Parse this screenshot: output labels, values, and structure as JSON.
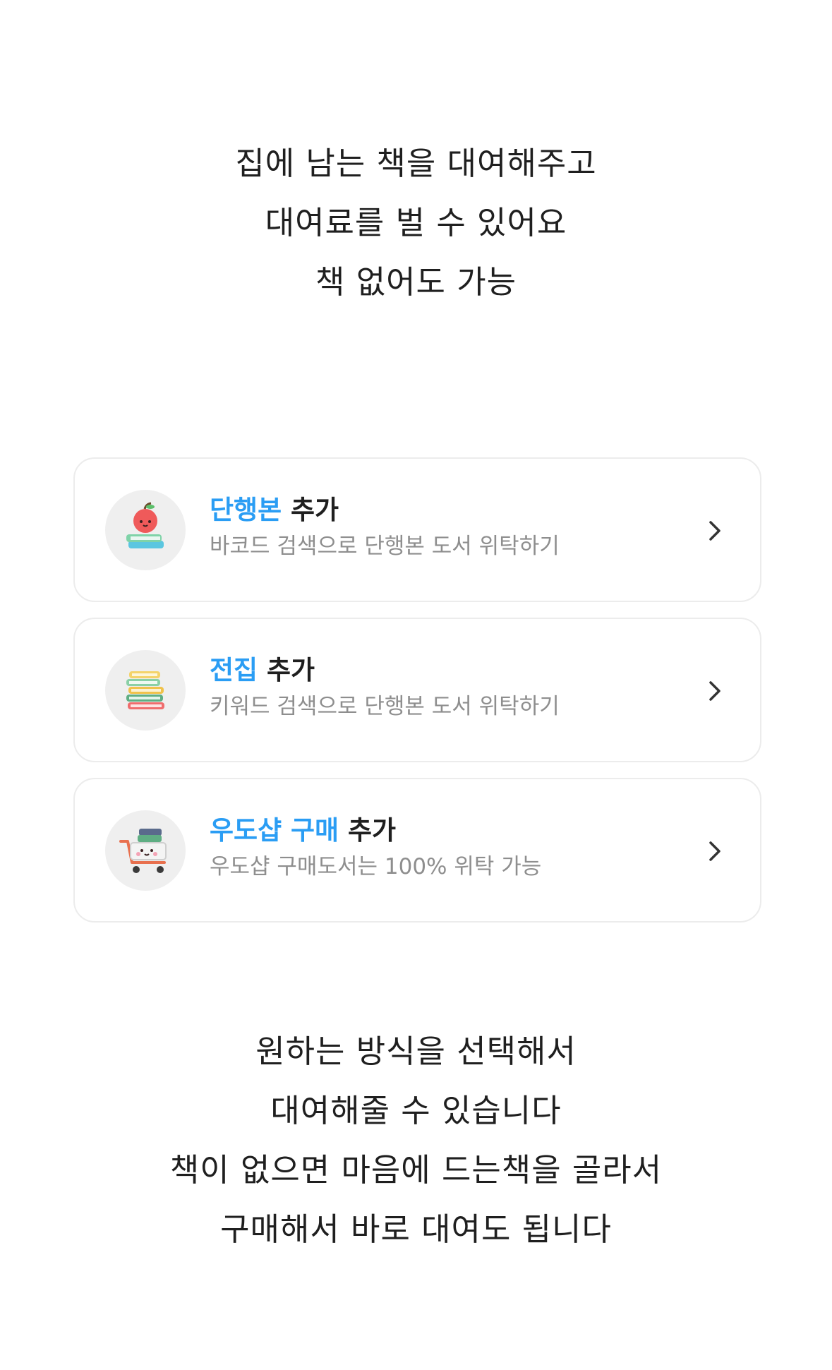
{
  "intro": {
    "lines": [
      "집에 남는 책을 대여해주고",
      "대여료를 벌 수 있어요",
      "책 없어도 가능"
    ]
  },
  "options": [
    {
      "title_highlight": "단행본",
      "title_rest": " 추가",
      "subtitle": "바코드 검색으로 단행본 도서 위탁하기",
      "icon": "apple-on-books-icon"
    },
    {
      "title_highlight": "전집",
      "title_rest": " 추가",
      "subtitle": "키워드 검색으로 단행본 도서 위탁하기",
      "icon": "book-stack-icon"
    },
    {
      "title_highlight": "우도샵 구매",
      "title_rest": " 추가",
      "subtitle": "우도샵 구매도서는 100% 위탁 가능",
      "icon": "shopping-cart-books-icon"
    }
  ],
  "outro": {
    "lines": [
      "원하는 방식을 선택해서",
      "대여해줄 수 있습니다",
      "책이 없으면 마음에 드는책을 골라서",
      "구매해서 바로 대여도 됩니다"
    ]
  },
  "colors": {
    "accent": "#2a9df4",
    "subtitle": "#8e8e8e",
    "card_border": "#ececec",
    "icon_bg": "#efefef"
  }
}
